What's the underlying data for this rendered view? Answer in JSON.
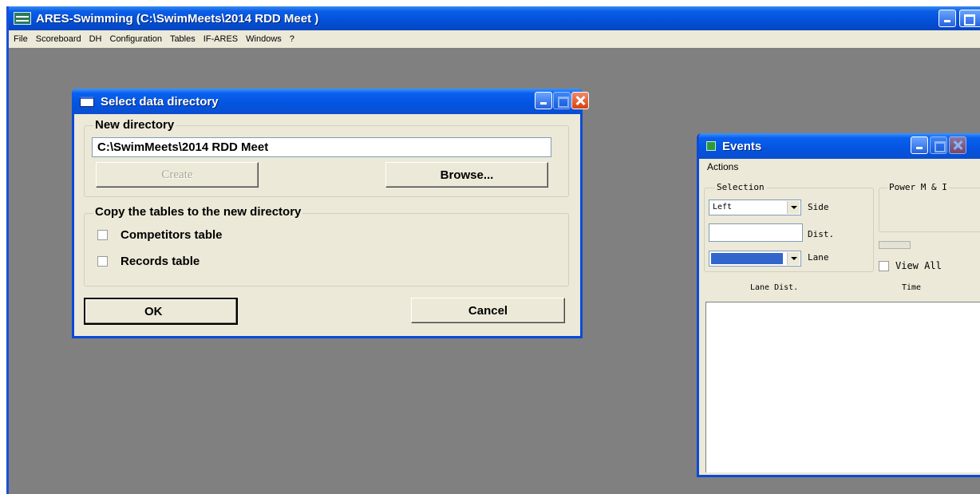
{
  "app": {
    "title": "ARES-Swimming (C:\\SwimMeets\\2014 RDD Meet )",
    "menu": [
      "File",
      "Scoreboard",
      "DH",
      "Configuration",
      "Tables",
      "IF-ARES",
      "Windows",
      "?"
    ]
  },
  "dialog": {
    "title": "Select data directory",
    "new_directory_label": "New directory",
    "directory_value": "C:\\SwimMeets\\2014 RDD Meet",
    "create_label": "Create",
    "browse_label": "Browse...",
    "copy_group_label": "Copy the tables to the new directory",
    "competitors_label": "Competitors table",
    "records_label": "Records table",
    "ok_label": "OK",
    "cancel_label": "Cancel"
  },
  "events": {
    "title": "Events",
    "menu_actions": "Actions",
    "selection_label": "Selection",
    "power_label": "Power M & I",
    "side_value": "Left",
    "side_label": "Side",
    "dist_label": "Dist.",
    "lane_label": "Lane",
    "lane_color": "#3366cc",
    "view_all_label": "View All",
    "col_lane_dist": "Lane Dist.",
    "col_time": "Time"
  }
}
